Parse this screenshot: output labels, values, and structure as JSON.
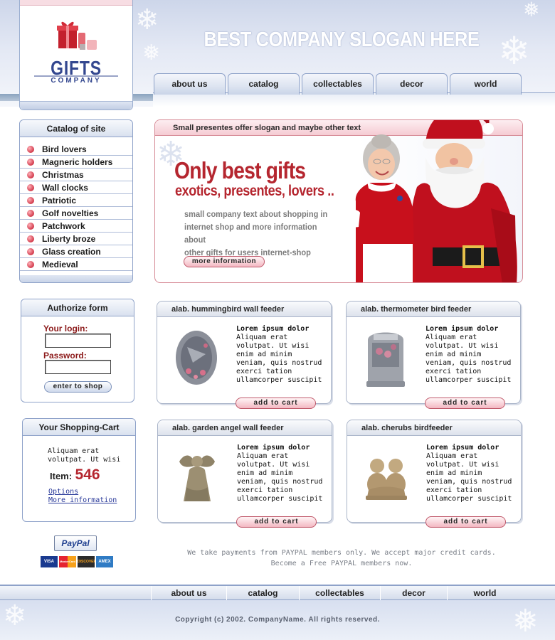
{
  "brand": {
    "name": "GIFTS",
    "subtitle": "COMPANY",
    "slogan": "BEST COMPANY SLOGAN HERE"
  },
  "nav": {
    "items": [
      "about us",
      "catalog",
      "collectables",
      "decor",
      "world"
    ]
  },
  "catalog": {
    "title": "Catalog of site",
    "items": [
      "Bird lovers",
      "Magneric holders",
      "Christmas",
      "Wall clocks",
      "Patriotic",
      "Golf novelties",
      "Patchwork",
      "Liberty broze",
      "Glass creation",
      "Medieval"
    ]
  },
  "authorize": {
    "title": "Authorize form",
    "login_label": "Your login:",
    "login_value": "",
    "password_label": "Password:",
    "password_value": "",
    "button": "enter to shop"
  },
  "cart": {
    "title": "Your Shopping-Cart",
    "text_line1": "Aliquam erat",
    "text_line2": "volutpat. Ut wisi",
    "item_label": "Item:",
    "item_count": "546",
    "options_link": "Options",
    "more_link": "More information"
  },
  "payment": {
    "paypal_logo": "PayPal",
    "cards": [
      "VISA",
      "MasterCard",
      "DISCOVER",
      "AMEX"
    ],
    "note_line1": "We take payments from PAYPAL members only. We accept major credit cards.",
    "note_line2": "Become a Free PAYPAL members now."
  },
  "banner": {
    "top_text": "Small presentes offer slogan and maybe other text",
    "headline": "Only best gifts",
    "subheadline": "exotics, presentes, lovers ..",
    "text_line1": "small company text about shopping in",
    "text_line2": "internet shop and more information about",
    "text_line3": "other gifts for users internet-shop",
    "button": "more information"
  },
  "products": [
    {
      "title": "alab. hummingbird wall feeder",
      "heading": "Lorem ipsum dolor",
      "lines": [
        "Aliquam erat",
        "volutpat. Ut wisi",
        "enim ad minim",
        "veniam, quis nostrud",
        "exerci tation",
        "ullamcorper suscipit"
      ],
      "button": "add to cart",
      "icon": "hummingbird-feeder-icon"
    },
    {
      "title": "alab. thermometer bird  feeder",
      "heading": "Lorem ipsum dolor",
      "lines": [
        "Aliquam erat",
        "volutpat. Ut wisi",
        "enim ad minim",
        "veniam, quis nostrud",
        "exerci tation",
        "ullamcorper suscipit"
      ],
      "button": "add to cart",
      "icon": "thermometer-feeder-icon"
    },
    {
      "title": "alab. garden angel wall feeder",
      "heading": "Lorem ipsum dolor",
      "lines": [
        "Aliquam erat",
        "volutpat. Ut wisi",
        "enim ad minim",
        "veniam, quis nostrud",
        "exerci tation",
        "ullamcorper suscipit"
      ],
      "button": "add to cart",
      "icon": "angel-statue-icon"
    },
    {
      "title": "alab. cherubs birdfeeder",
      "heading": "Lorem ipsum dolor",
      "lines": [
        "Aliquam erat",
        "volutpat. Ut wisi",
        "enim ad minim",
        "veniam, quis nostrud",
        "exerci tation",
        "ullamcorper suscipit"
      ],
      "button": "add to cart",
      "icon": "cherubs-statue-icon"
    }
  ],
  "footer": {
    "nav": [
      "about us",
      "catalog",
      "collectables",
      "decor",
      "world"
    ],
    "copyright": "Copyright (c) 2002. CompanyName. All rights reserved."
  },
  "colors": {
    "accent_red": "#b5262f",
    "brand_blue": "#33478f",
    "border_blue": "#8ea2c9"
  }
}
